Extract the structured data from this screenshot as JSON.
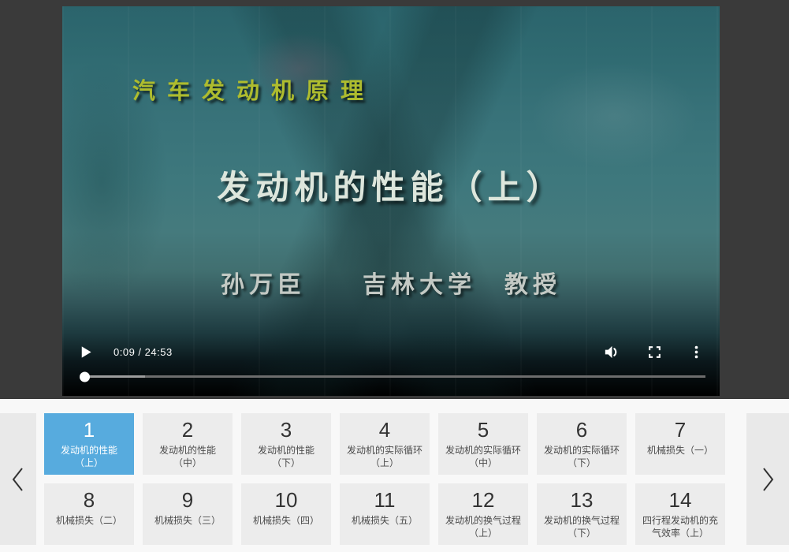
{
  "player": {
    "overlay": {
      "series_title": "汽车发动机原理",
      "episode_title": "发动机的性能（上）",
      "presenter": "孙万臣　　吉林大学　教授"
    },
    "controls": {
      "time_display": "0:09 / 24:53",
      "played_percent": 0.8,
      "buffered_percent": 10
    }
  },
  "playlist": {
    "items": [
      {
        "number": "1",
        "title": "发动机的性能\n（上）",
        "active": true
      },
      {
        "number": "2",
        "title": "发动机的性能\n（中）"
      },
      {
        "number": "3",
        "title": "发动机的性能\n（下）"
      },
      {
        "number": "4",
        "title": "发动机的实际循环\n（上）"
      },
      {
        "number": "5",
        "title": "发动机的实际循环\n（中）"
      },
      {
        "number": "6",
        "title": "发动机的实际循环\n（下）"
      },
      {
        "number": "7",
        "title": "机械损失（一）"
      },
      {
        "number": "8",
        "title": "机械损失（二）"
      },
      {
        "number": "9",
        "title": "机械损失（三）"
      },
      {
        "number": "10",
        "title": "机械损失（四）"
      },
      {
        "number": "11",
        "title": "机械损失（五）"
      },
      {
        "number": "12",
        "title": "发动机的换气过程\n（上）"
      },
      {
        "number": "13",
        "title": "发动机的换气过程\n（下）"
      },
      {
        "number": "14",
        "title": "四行程发动机的充\n气效率（上）"
      }
    ]
  },
  "icons": {
    "play": "play-icon",
    "volume": "volume-icon",
    "fullscreen": "fullscreen-icon",
    "more": "kebab-menu-icon",
    "prev": "chevron-left-icon",
    "next": "chevron-right-icon"
  },
  "colors": {
    "active_card_bg": "#57abde",
    "card_bg": "#ececec",
    "pager_bg": "#e9e9e9",
    "playlist_bg": "#f8f8f8",
    "player_bg": "#3a3a3a",
    "accent_text_yellow": "#aebc2e"
  }
}
